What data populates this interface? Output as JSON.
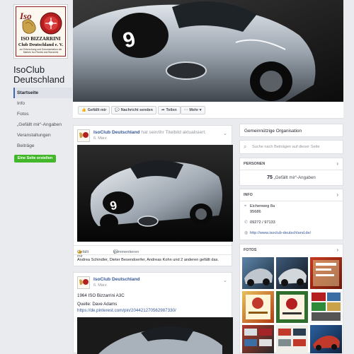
{
  "logo": {
    "brand_mark": "Iso",
    "line1": "ISO BIZZARRINI",
    "line2": "Club Deutschland e. V.",
    "line3": "zur Erforschung und Dokumentation der Marken Iso Rivolta und Bizzarrini"
  },
  "page": {
    "name": "IsoClub Deutschland"
  },
  "nav": {
    "items": [
      {
        "label": "Startseite",
        "active": true
      },
      {
        "label": "Info"
      },
      {
        "label": "Fotos"
      },
      {
        "label": "„Gefällt mir“-Angaben"
      },
      {
        "label": "Veranstaltungen"
      },
      {
        "label": "Beiträge"
      }
    ],
    "create_button": "Eine Seite erstellen"
  },
  "actionbar": {
    "like": "Gefällt mir",
    "message": "Nachricht senden",
    "share": "Teilen",
    "more": "Mehr"
  },
  "post1": {
    "author": "IsoClub Deutschland",
    "action": "hat sein/ihr Titelbild aktualisiert.",
    "date": "6. März",
    "like": "Gefällt mir",
    "comment": "Kommentieren",
    "likes_text": "Andrea Schindler, Dieter Besendoerfer, Andreas Kohn und 2 anderen gefällt das."
  },
  "post2": {
    "author": "IsoClub Deutschland",
    "date": "6. März",
    "text1": "1964 ISO Bizzarrini A3C",
    "text2": "Quelle: Dave Adams",
    "link": "https://de.pinterest.com/pin/204421270562987330/"
  },
  "sidebar": {
    "category": "Gemeinnützige Organisation",
    "search_placeholder": "Suche nach Beiträgen auf dieser Seite",
    "people": {
      "header": "PERSONEN",
      "count": "75",
      "label": "„Gefällt mir“-Angaben"
    },
    "info": {
      "header": "INFO",
      "street": "Eichenweg 8a",
      "zip": "95686",
      "phone": "09272 / 97133",
      "web": "http://www.isoclub-deutschland.de/"
    },
    "photos": {
      "header": "FOTOS"
    }
  },
  "colors": {
    "facebook_blue": "#4267b2",
    "link": "#365899",
    "create_green": "#42b72a",
    "background": "#e9ebee"
  },
  "icons": {
    "like": "thumbs-up-icon",
    "message": "chat-bubble-icon",
    "share": "share-arrow-icon",
    "search": "search-icon",
    "location": "map-pin-icon",
    "phone": "phone-icon",
    "web": "globe-icon"
  }
}
